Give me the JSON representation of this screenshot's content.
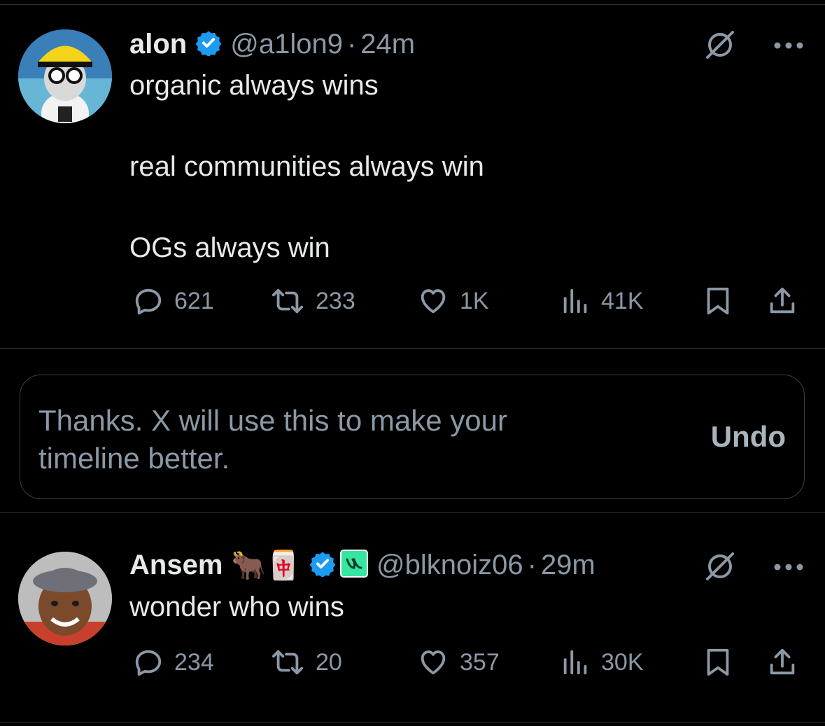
{
  "tweets": [
    {
      "name": "alon",
      "handle": "@a1lon9",
      "separator": "·",
      "time": "24m",
      "text": "organic always wins\n\nreal communities always win\n\nOGs always win",
      "stats": {
        "replies": "621",
        "reposts": "233",
        "likes": "1K",
        "views": "41K"
      }
    },
    {
      "name": "Ansem",
      "name_emojis": "🐂🀄",
      "handle": "@blknoiz06",
      "separator": "·",
      "time": "29m",
      "text": "wonder who wins",
      "stats": {
        "replies": "234",
        "reposts": "20",
        "likes": "357",
        "views": "30K"
      }
    }
  ],
  "notice": {
    "message": "Thanks. X will use this to make your timeline better.",
    "undo_label": "Undo"
  },
  "colors": {
    "background": "#000000",
    "text": "#e7e9ea",
    "secondary": "#8b98a5",
    "verified": "#1d9bf0",
    "affiliate_badge": "#35e6a0"
  },
  "icons": {
    "more": "more-icon",
    "grok": "grok-icon",
    "reply": "reply-icon",
    "repost": "repost-icon",
    "like": "like-icon",
    "views": "views-icon",
    "bookmark": "bookmark-icon",
    "share": "share-icon"
  }
}
